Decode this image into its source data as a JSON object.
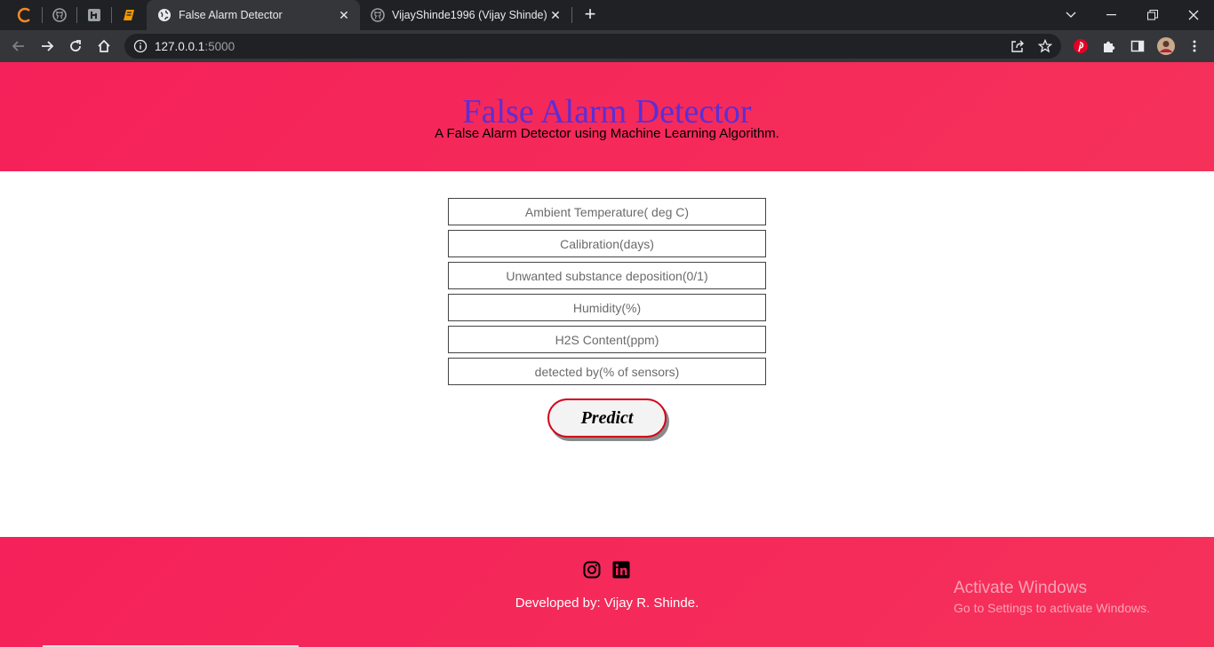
{
  "browser": {
    "tabs": [
      {
        "title": "False Alarm Detector",
        "active": true
      },
      {
        "title": "VijayShinde1996 (Vijay Shinde)",
        "active": false
      }
    ],
    "url_host": "127.0.0.1",
    "url_port": ":5000"
  },
  "page": {
    "title": "False Alarm Detector",
    "subtitle": "A False Alarm Detector using Machine Learning Algorithm.",
    "fields": [
      {
        "placeholder": "Ambient Temperature( deg C)"
      },
      {
        "placeholder": "Calibration(days)"
      },
      {
        "placeholder": "Unwanted substance deposition(0/1)"
      },
      {
        "placeholder": "Humidity(%)"
      },
      {
        "placeholder": "H2S Content(ppm)"
      },
      {
        "placeholder": "detected by(% of sensors)"
      }
    ],
    "predict_label": "Predict"
  },
  "footer": {
    "credit": "Developed by: Vijay R. Shinde."
  },
  "watermark": {
    "line1": "Activate Windows",
    "line2": "Go to Settings to activate Windows."
  },
  "colors": {
    "banner": "#f5215a",
    "title": "#5a2fd6",
    "button_border": "#d4001c"
  }
}
